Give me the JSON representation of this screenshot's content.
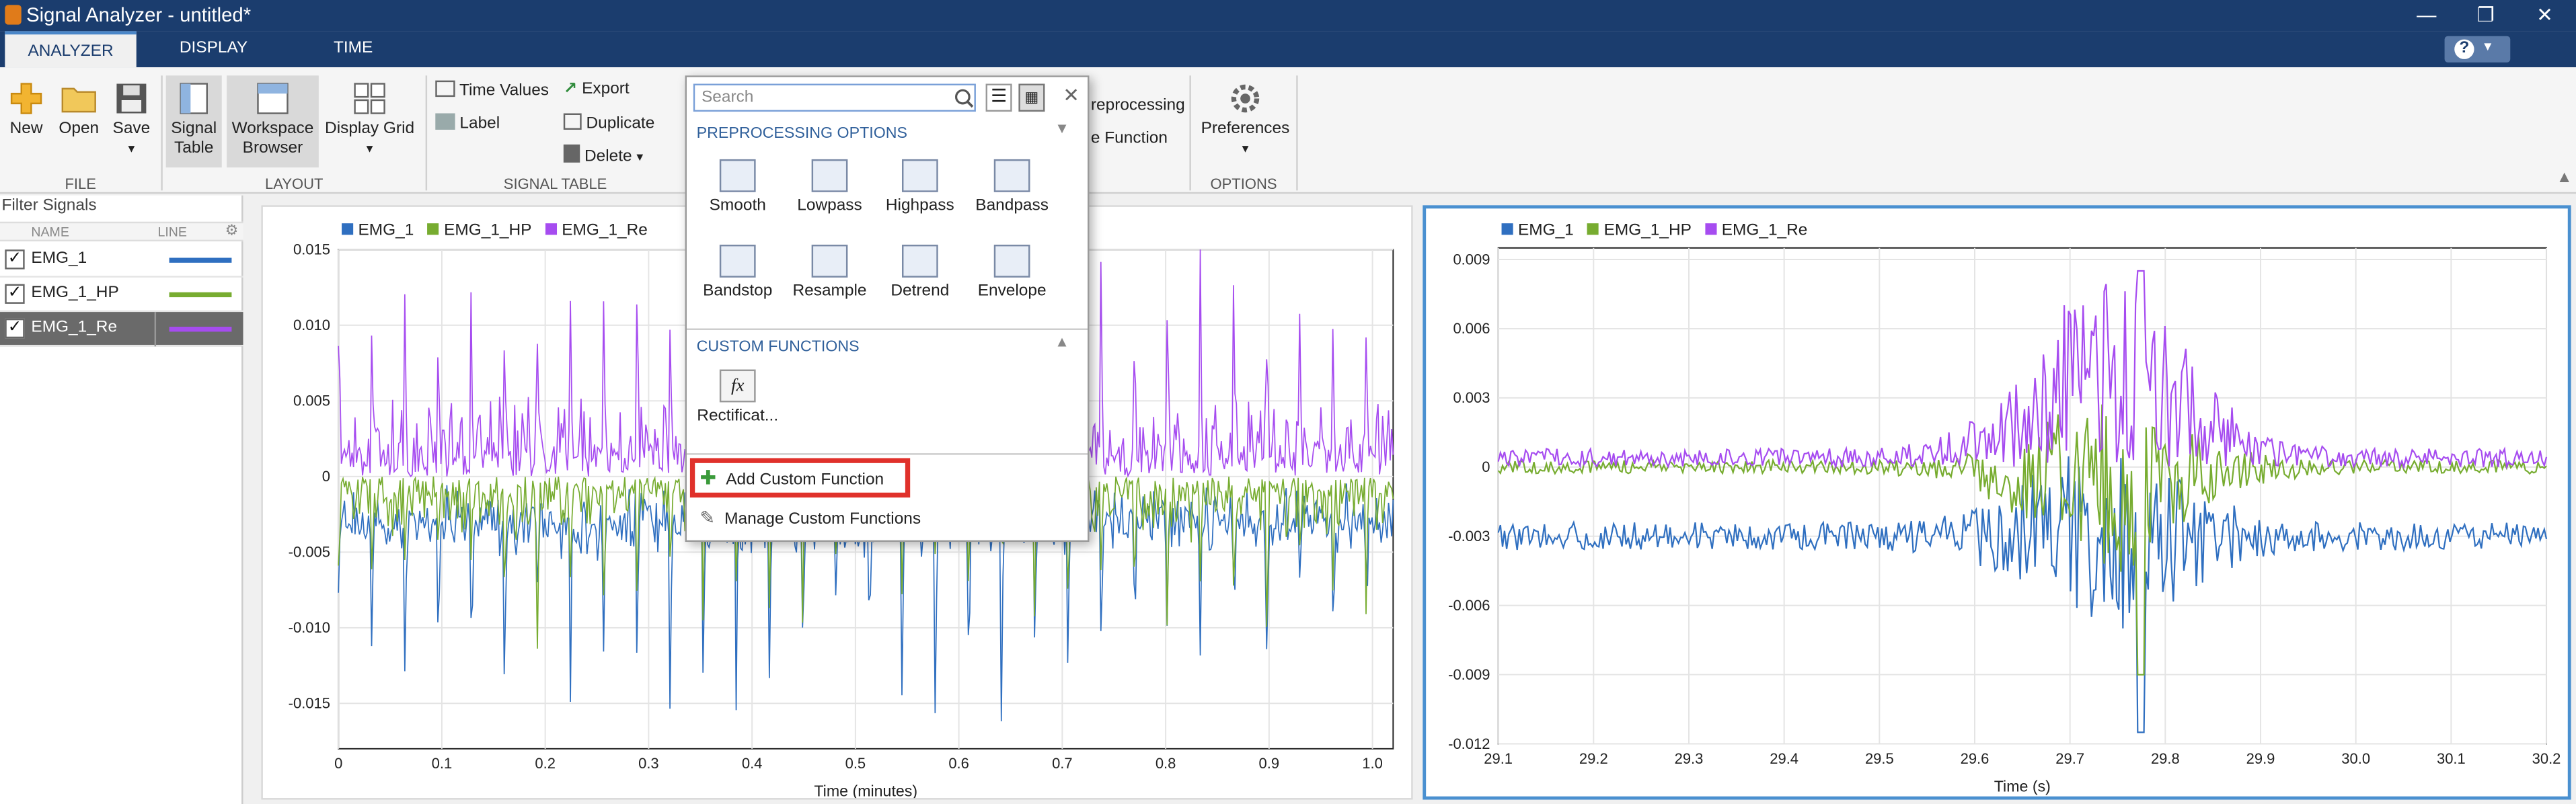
{
  "window": {
    "title": "Signal Analyzer - untitled*"
  },
  "tabs": [
    "ANALYZER",
    "DISPLAY",
    "TIME"
  ],
  "ribbon": {
    "file": {
      "label": "FILE",
      "new": "New",
      "open": "Open",
      "save": "Save"
    },
    "layout": {
      "label": "LAYOUT",
      "signal_table": [
        "Signal",
        "Table"
      ],
      "workspace_browser": [
        "Workspace",
        "Browser"
      ],
      "display_grid": "Display Grid"
    },
    "signal_table": {
      "label": "SIGNAL TABLE",
      "time_values": "Time Values",
      "label_btn": "Label",
      "export": "Export",
      "duplicate": "Duplicate",
      "delete": "Delete"
    },
    "partial_items": [
      "reprocessing",
      "e Function"
    ],
    "options": {
      "label": "OPTIONS",
      "preferences": "Preferences"
    }
  },
  "signals_panel": {
    "filter_label": "Filter Signals",
    "col_name": "NAME",
    "col_line": "LINE",
    "rows": [
      {
        "name": "EMG_1",
        "checked": true,
        "color": "#2f6fc0",
        "selected": false
      },
      {
        "name": "EMG_1_HP",
        "checked": true,
        "color": "#77ac30",
        "selected": false
      },
      {
        "name": "EMG_1_Re",
        "checked": true,
        "color": "#a64cf0",
        "selected": true
      }
    ]
  },
  "popup": {
    "search_placeholder": "Search",
    "preprocessing_header": "PREPROCESSING OPTIONS",
    "options": [
      "Smooth",
      "Lowpass",
      "Highpass",
      "Bandpass",
      "Bandstop",
      "Resample",
      "Detrend",
      "Envelope"
    ],
    "custom_header": "CUSTOM FUNCTIONS",
    "custom_items": [
      "Rectificat..."
    ],
    "add_custom": "Add Custom Function",
    "manage_custom": "Manage Custom Functions",
    "highlight_color": "#e0312b"
  },
  "legend": [
    "EMG_1",
    "EMG_1_HP",
    "EMG_1_Re"
  ],
  "colors": {
    "emg1": "#2f6fc0",
    "emg1hp": "#77ac30",
    "emg1re": "#a64cf0",
    "accent": "#4a90d0",
    "titlebar": "#1b3d6e"
  },
  "chart_data": [
    {
      "type": "line",
      "xlabel": "Time (minutes)",
      "ylabel": "",
      "xlim": [
        0,
        1.02
      ],
      "ylim": [
        -0.018,
        0.015
      ],
      "xticks": [
        "0",
        "0.1",
        "0.2",
        "0.3",
        "0.4",
        "0.5",
        "0.6",
        "0.7",
        "0.8",
        "0.9",
        "1.0"
      ],
      "yticks": [
        "0.015",
        "0.010",
        "0.005",
        "0",
        "-0.005",
        "-0.010",
        "-0.015"
      ],
      "series": [
        {
          "name": "EMG_1",
          "baseline": -0.003,
          "spike_min": -0.0165
        },
        {
          "name": "EMG_1_HP",
          "baseline": 0,
          "range": [
            -0.009,
            0.001
          ]
        },
        {
          "name": "EMG_1_Re",
          "baseline": 0,
          "spike_max": 0.0118
        }
      ],
      "grid": true
    },
    {
      "type": "line",
      "xlabel": "Time (s)",
      "ylabel": "",
      "xlim": [
        29.1,
        30.2
      ],
      "ylim": [
        -0.012,
        0.0095
      ],
      "xticks": [
        "29.1",
        "29.2",
        "29.3",
        "29.4",
        "29.5",
        "29.6",
        "29.7",
        "29.8",
        "29.9",
        "30.0",
        "30.1",
        "30.2"
      ],
      "yticks": [
        "0.009",
        "0.006",
        "0.003",
        "0",
        "-0.003",
        "-0.006",
        "-0.009",
        "-0.012"
      ],
      "series": [
        {
          "name": "EMG_1",
          "baseline": -0.003,
          "spike_min": -0.0115
        },
        {
          "name": "EMG_1_HP",
          "baseline": 0,
          "spike_min": -0.009
        },
        {
          "name": "EMG_1_Re",
          "baseline": 0,
          "spike_max": 0.0085
        }
      ],
      "grid": true
    }
  ]
}
